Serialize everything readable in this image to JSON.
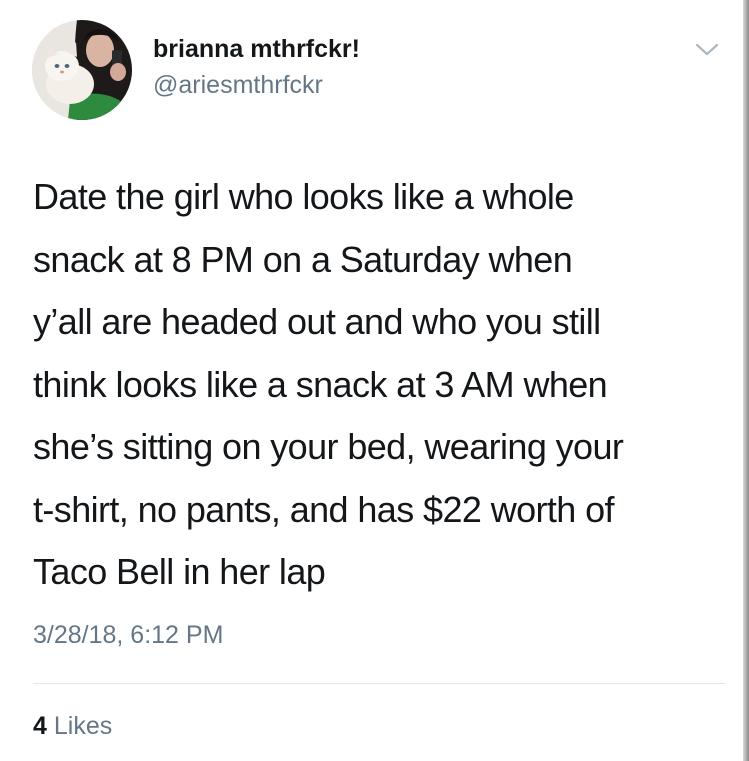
{
  "tweet": {
    "author": {
      "display_name": "brianna mthrfckr!",
      "handle": "@ariesmthrfckr",
      "avatar_icon": "user-avatar-photo"
    },
    "menu_icon": "chevron-down-icon",
    "text_lines": [
      "Date the girl who looks like a whole",
      "snack at 8 PM on a Saturday when",
      "y’all are headed out and who you still",
      "think looks like a snack at 3 AM when",
      "she’s sitting on your bed, wearing your",
      "t-shirt, no pants, and has $22 worth of",
      "Taco Bell in her lap"
    ],
    "timestamp": "3/28/18, 6:12 PM",
    "likes": {
      "count": "4",
      "label": "Likes"
    }
  },
  "colors": {
    "text_primary": "#14171a",
    "text_secondary": "#657786",
    "divider": "#e1e8ed",
    "background": "#ffffff"
  }
}
